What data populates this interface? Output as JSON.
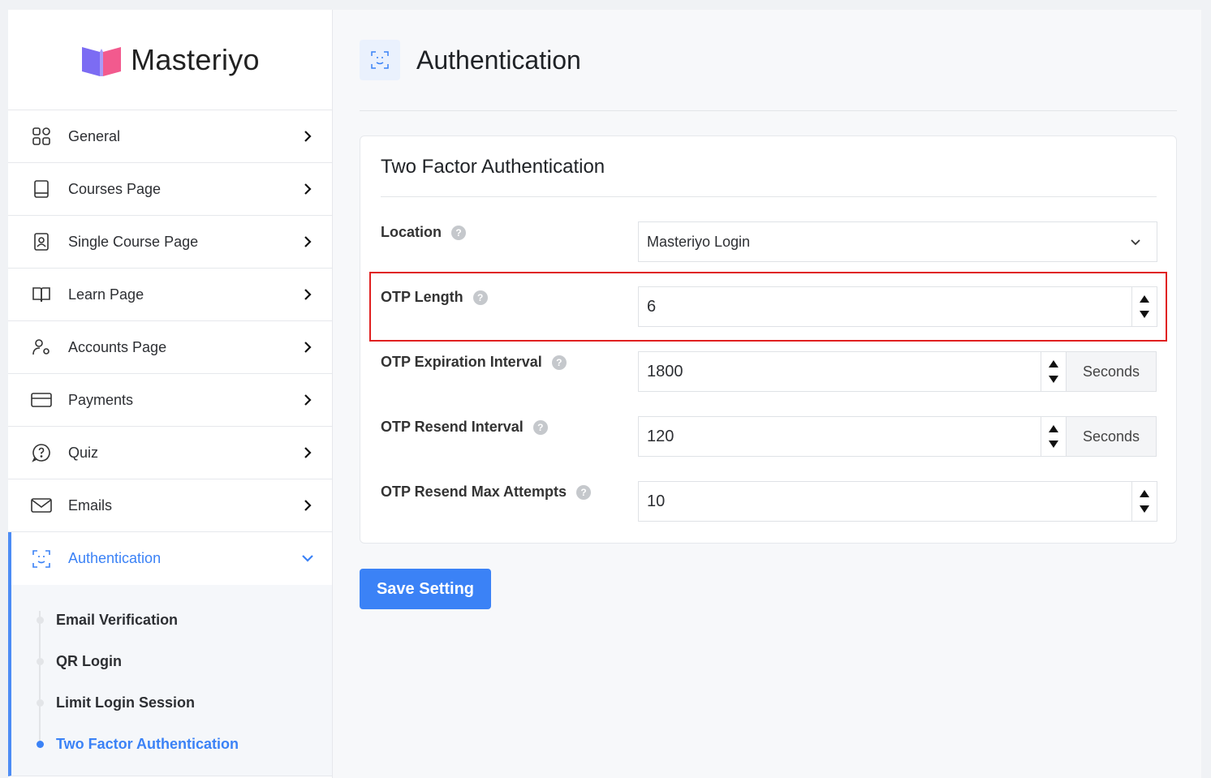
{
  "brand": {
    "name": "Masteriyo",
    "logo_colors": [
      "#7c6cf3",
      "#f25a8e"
    ]
  },
  "sidebar": {
    "items": [
      {
        "label": "General",
        "icon": "grid-icon"
      },
      {
        "label": "Courses Page",
        "icon": "book-icon"
      },
      {
        "label": "Single Course Page",
        "icon": "contact-book-icon"
      },
      {
        "label": "Learn Page",
        "icon": "open-book-icon"
      },
      {
        "label": "Accounts Page",
        "icon": "user-gear-icon"
      },
      {
        "label": "Payments",
        "icon": "credit-card-icon"
      },
      {
        "label": "Quiz",
        "icon": "chat-question-icon"
      },
      {
        "label": "Emails",
        "icon": "mail-icon"
      },
      {
        "label": "Authentication",
        "icon": "face-scan-icon",
        "active": true
      }
    ],
    "sub_items": [
      {
        "label": "Email Verification"
      },
      {
        "label": "QR Login"
      },
      {
        "label": "Limit Login Session"
      },
      {
        "label": "Two Factor Authentication",
        "active": true
      }
    ]
  },
  "header": {
    "title": "Authentication",
    "icon": "face-scan-icon"
  },
  "card": {
    "title": "Two Factor Authentication",
    "fields": {
      "location": {
        "label": "Location",
        "value": "Masteriyo Login"
      },
      "otp_length": {
        "label": "OTP Length",
        "value": "6"
      },
      "otp_expiration": {
        "label": "OTP Expiration Interval",
        "value": "1800",
        "unit": "Seconds"
      },
      "otp_resend": {
        "label": "OTP Resend Interval",
        "value": "120",
        "unit": "Seconds"
      },
      "otp_max_attempts": {
        "label": "OTP Resend Max Attempts",
        "value": "10"
      }
    },
    "help_glyph": "?"
  },
  "actions": {
    "save_label": "Save Setting"
  },
  "colors": {
    "accent": "#3b82f6",
    "highlight": "#e02020"
  }
}
